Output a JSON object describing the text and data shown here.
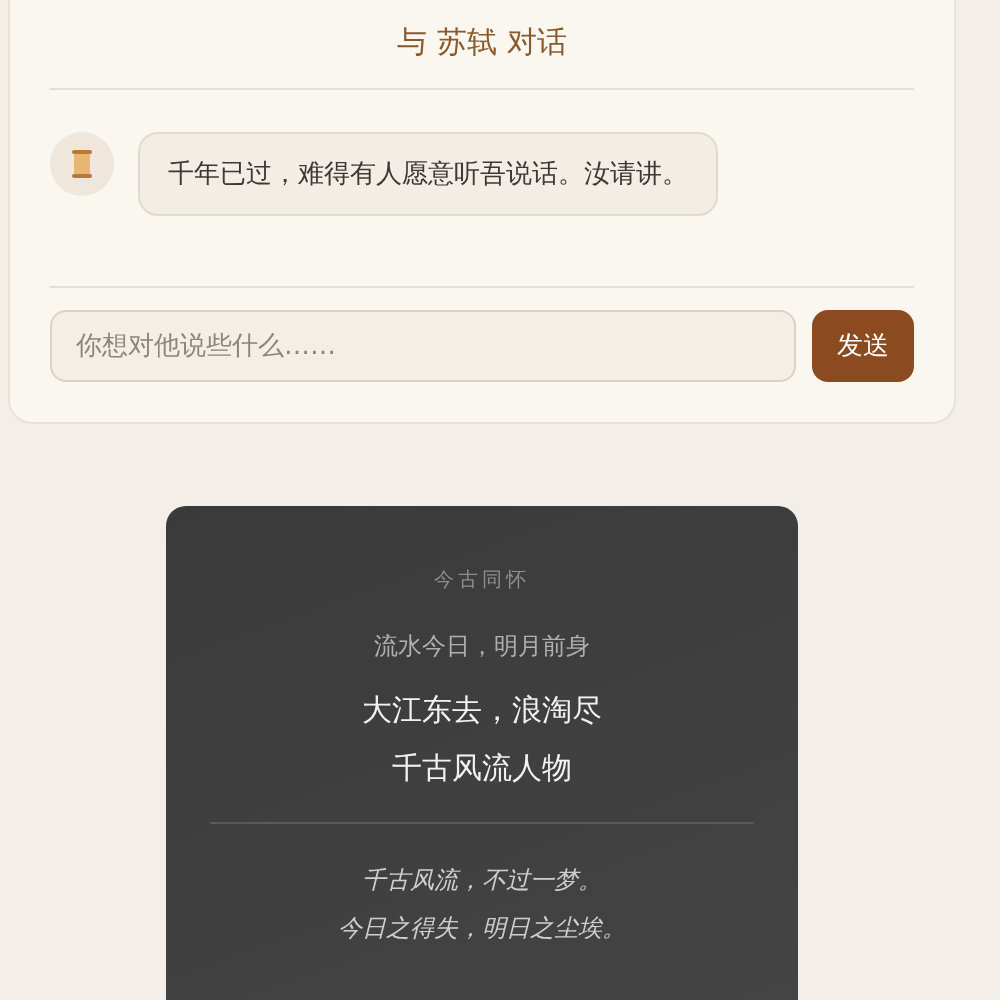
{
  "chat": {
    "title": "与 苏轼 对话",
    "messages": [
      {
        "text": "千年已过，难得有人愿意听吾说话。汝请讲。"
      }
    ],
    "input": {
      "placeholder": "你想对他说些什么……"
    },
    "send_button": "发送"
  },
  "quote_card": {
    "heading": "今古同怀",
    "subtitle": "流水今日，明月前身",
    "verse": [
      "大江东去，浪淘尽",
      "千古风流人物"
    ],
    "reflection": [
      "千古风流，不过一梦。",
      "今日之得失，明日之尘埃。"
    ]
  }
}
